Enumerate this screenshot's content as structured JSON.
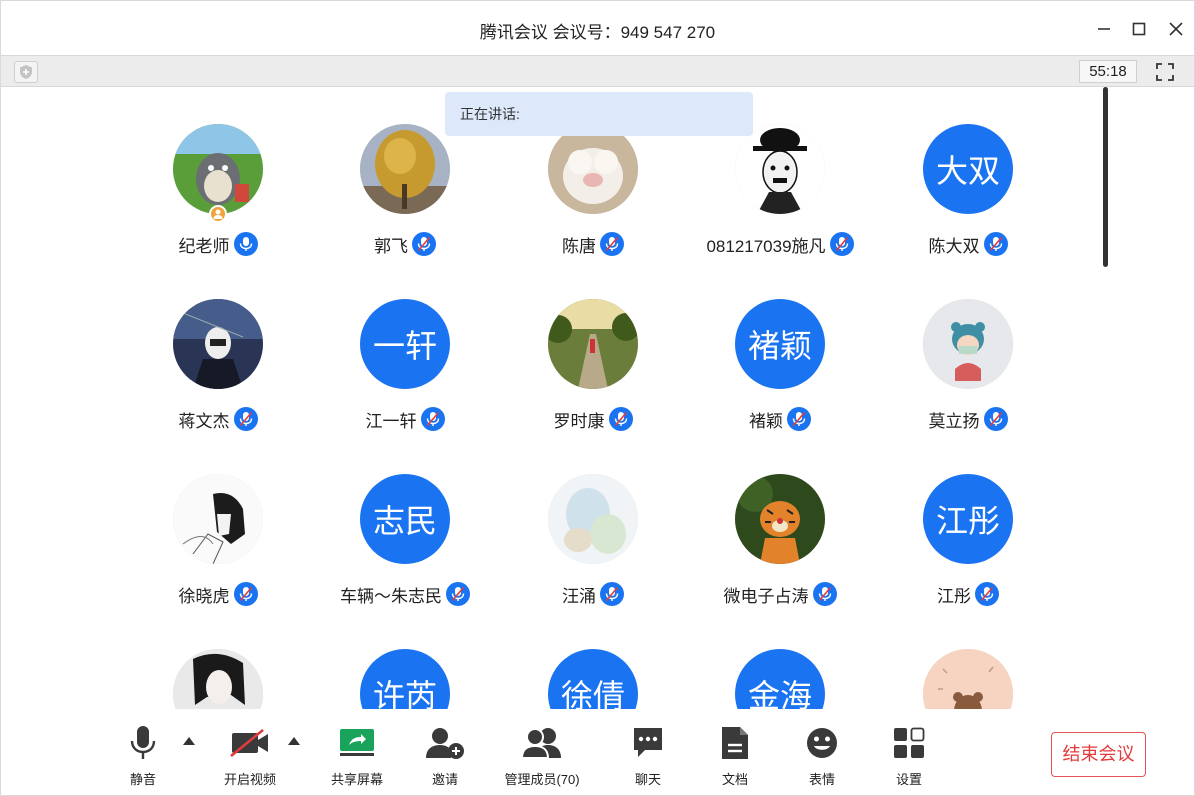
{
  "window": {
    "title": "腾讯会议 会议号：949 547 270"
  },
  "infobar": {
    "timer": "55:18"
  },
  "speaking": {
    "label": "正在讲话:"
  },
  "participants": [
    {
      "name": "纪老师",
      "avatar_text": "",
      "avatar_type": "image",
      "avatar_hint": "totoro",
      "host": true,
      "mic": "on"
    },
    {
      "name": "郭飞",
      "avatar_text": "",
      "avatar_type": "image",
      "avatar_hint": "tree",
      "mic": "muted"
    },
    {
      "name": "陈唐",
      "avatar_text": "",
      "avatar_type": "image",
      "avatar_hint": "sheep",
      "mic": "muted"
    },
    {
      "name": "081217039施凡",
      "avatar_text": "",
      "avatar_type": "image",
      "avatar_hint": "chaplin",
      "mic": "muted"
    },
    {
      "name": "陈大双",
      "avatar_text": "大双",
      "avatar_type": "text",
      "mic": "muted"
    },
    {
      "name": "蒋文杰",
      "avatar_text": "",
      "avatar_type": "image",
      "avatar_hint": "night",
      "mic": "muted"
    },
    {
      "name": "江一轩",
      "avatar_text": "一轩",
      "avatar_type": "text",
      "mic": "muted"
    },
    {
      "name": "罗时康",
      "avatar_text": "",
      "avatar_type": "image",
      "avatar_hint": "road",
      "mic": "muted"
    },
    {
      "name": "褚颖",
      "avatar_text": "褚颖",
      "avatar_type": "text",
      "mic": "muted"
    },
    {
      "name": "莫立扬",
      "avatar_text": "",
      "avatar_type": "image",
      "avatar_hint": "cartoon-kid",
      "mic": "muted"
    },
    {
      "name": "徐晓虎",
      "avatar_text": "",
      "avatar_type": "image",
      "avatar_hint": "sketch",
      "mic": "muted"
    },
    {
      "name": "车辆～朱志民",
      "avatar_text": "志民",
      "avatar_type": "text",
      "mic": "muted"
    },
    {
      "name": "汪涌",
      "avatar_text": "",
      "avatar_type": "image",
      "avatar_hint": "watercolor",
      "mic": "muted"
    },
    {
      "name": "微电子占涛",
      "avatar_text": "",
      "avatar_type": "image",
      "avatar_hint": "tigger",
      "mic": "muted"
    },
    {
      "name": "江彤",
      "avatar_text": "江彤",
      "avatar_type": "text",
      "mic": "muted"
    },
    {
      "name": "",
      "avatar_text": "",
      "avatar_type": "image",
      "avatar_hint": "anime",
      "mic": "none"
    },
    {
      "name": "",
      "avatar_text": "许芮",
      "avatar_type": "text",
      "mic": "none"
    },
    {
      "name": "",
      "avatar_text": "徐倩",
      "avatar_type": "text",
      "mic": "none"
    },
    {
      "name": "",
      "avatar_text": "金海",
      "avatar_type": "text",
      "mic": "none"
    },
    {
      "name": "",
      "avatar_text": "",
      "avatar_type": "image",
      "avatar_hint": "bear",
      "mic": "none"
    }
  ],
  "toolbar": {
    "mute": "静音",
    "video": "开启视频",
    "share": "共享屏幕",
    "invite": "邀请",
    "members": "管理成员(70)",
    "chat": "聊天",
    "docs": "文档",
    "emoji": "表情",
    "settings": "设置",
    "end": "结束会议"
  },
  "colors": {
    "accent": "#1a74f1",
    "end": "#e33b3b",
    "share": "#1aa35a"
  }
}
